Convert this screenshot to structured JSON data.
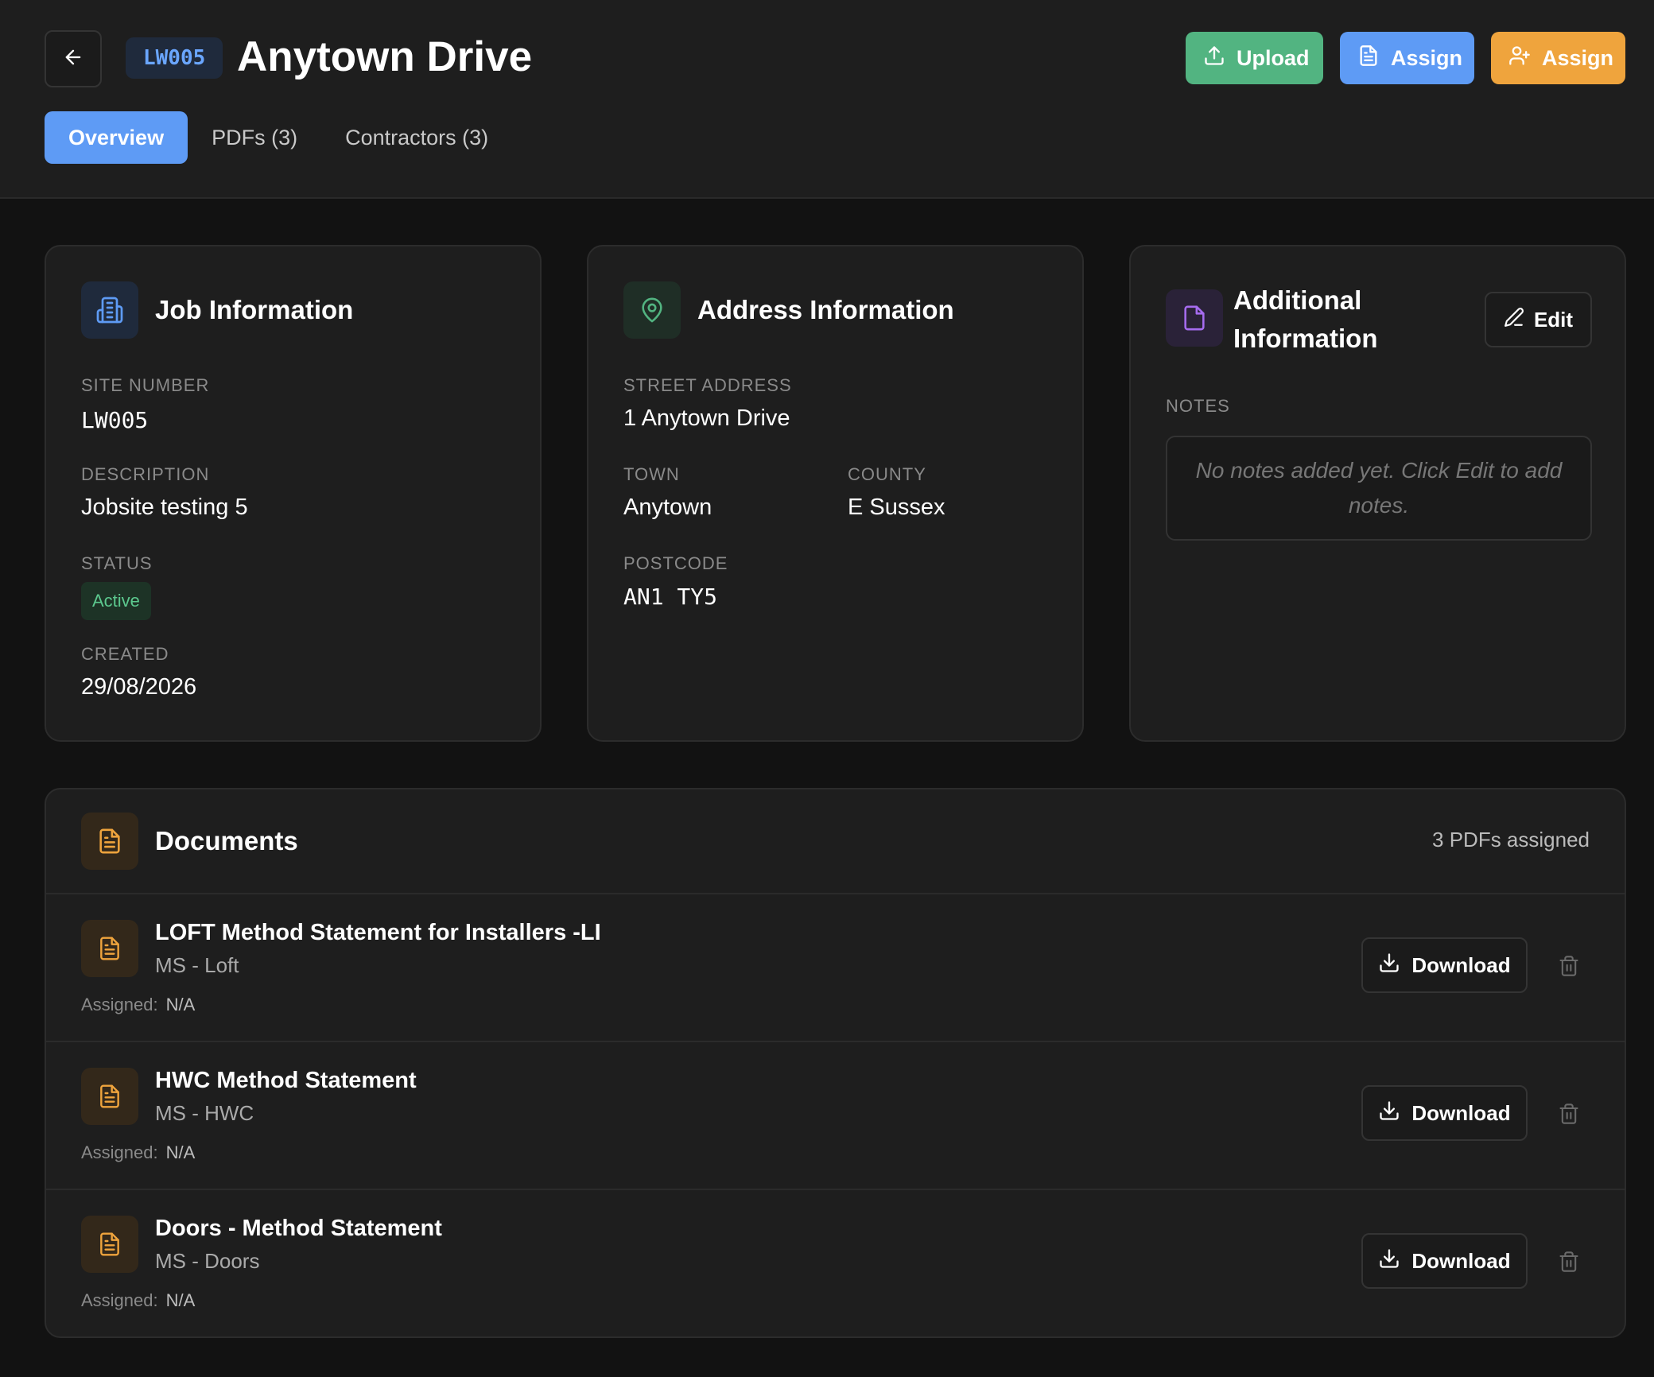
{
  "header": {
    "site_code": "LW005",
    "title": "Anytown Drive",
    "buttons": {
      "upload": "Upload",
      "assign_pdf": "Assign",
      "assign_contractor": "Assign"
    },
    "tabs": [
      {
        "label": "Overview",
        "active": true
      },
      {
        "label": "PDFs (3)",
        "active": false
      },
      {
        "label": "Contractors (3)",
        "active": false
      }
    ]
  },
  "job_info": {
    "title": "Job Information",
    "site_number_label": "SITE NUMBER",
    "site_number": "LW005",
    "description_label": "DESCRIPTION",
    "description": "Jobsite testing 5",
    "status_label": "STATUS",
    "status": "Active",
    "created_label": "CREATED",
    "created": "29/08/2026"
  },
  "address_info": {
    "title": "Address Information",
    "street_label": "STREET ADDRESS",
    "street": "1 Anytown Drive",
    "town_label": "TOWN",
    "town": "Anytown",
    "county_label": "COUNTY",
    "county": "E Sussex",
    "postcode_label": "POSTCODE",
    "postcode": "AN1 TY5"
  },
  "additional_info": {
    "title_line1": "Additional",
    "title_line2": "Information",
    "edit_label": "Edit",
    "notes_label": "NOTES",
    "notes_placeholder": "No notes added yet. Click Edit to add notes."
  },
  "documents": {
    "title": "Documents",
    "count_text": "3 PDFs assigned",
    "assigned_label": "Assigned:",
    "download_label": "Download",
    "items": [
      {
        "title": "LOFT Method Statement for Installers -LI",
        "subtitle": "MS - Loft",
        "assigned": "N/A"
      },
      {
        "title": "HWC Method Statement",
        "subtitle": "MS - HWC",
        "assigned": "N/A"
      },
      {
        "title": "Doors - Method Statement",
        "subtitle": "MS - Doors",
        "assigned": "N/A"
      }
    ]
  },
  "colors": {
    "upload": "#52b481",
    "assign_pdf": "#5e9bf5",
    "assign_contractor": "#efa43d",
    "status_active": "#5cc88e",
    "background": "#121212",
    "card": "#1e1e1e"
  },
  "icons": {
    "back": "arrow-left-icon",
    "upload": "upload-icon",
    "assign_pdf": "file-text-icon",
    "assign_contractor": "user-plus-icon",
    "job": "building-icon",
    "address": "map-pin-icon",
    "additional": "file-icon",
    "edit": "pencil-icon",
    "document": "file-text-icon",
    "download": "download-icon",
    "delete": "trash-icon"
  }
}
